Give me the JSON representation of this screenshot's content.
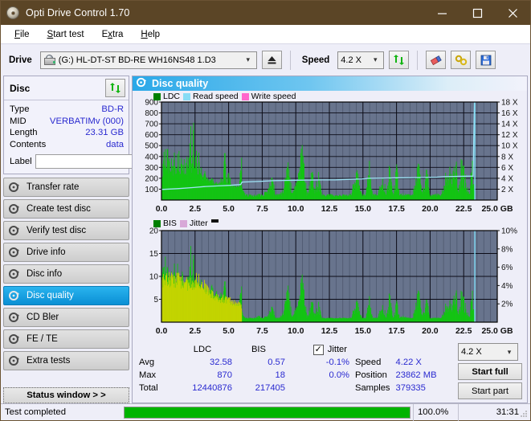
{
  "window": {
    "title": "Opti Drive Control 1.70",
    "icon": "disc-icon",
    "minimize": "minimize-icon",
    "maximize": "maximize-icon",
    "close": "close-icon"
  },
  "menu": [
    {
      "label": "File",
      "accel": "F"
    },
    {
      "label": "Start test",
      "accel": "S"
    },
    {
      "label": "Extra",
      "accel": "x"
    },
    {
      "label": "Help",
      "accel": "H"
    }
  ],
  "toolbar": {
    "drive_label": "Drive",
    "drive_value": "(G:)  HL-DT-ST BD-RE  WH16NS48 1.D3",
    "eject_icon": "eject-icon",
    "speed_label": "Speed",
    "speed_value": "4.2 X",
    "refresh_icon": "refresh-icon",
    "erase_icon": "eraser-icon",
    "tools_icon": "tools-icon",
    "save_icon": "save-disk-icon"
  },
  "disc_panel": {
    "title": "Disc",
    "refresh_icon": "refresh-icon",
    "rows": [
      {
        "key": "Type",
        "value": "BD-R"
      },
      {
        "key": "MID",
        "value": "VERBATIMv (000)"
      },
      {
        "key": "Length",
        "value": "23.31 GB"
      },
      {
        "key": "Contents",
        "value": "data"
      }
    ],
    "label_key": "Label",
    "label_value": "",
    "label_placeholder": "",
    "disc_button_icon": "cd-disc-icon"
  },
  "nav": {
    "items": [
      {
        "label": "Transfer rate",
        "icon": "disc-test-icon",
        "active": false
      },
      {
        "label": "Create test disc",
        "icon": "disc-test-icon",
        "active": false
      },
      {
        "label": "Verify test disc",
        "icon": "disc-test-icon",
        "active": false
      },
      {
        "label": "Drive info",
        "icon": "disc-test-icon",
        "active": false
      },
      {
        "label": "Disc info",
        "icon": "disc-test-icon",
        "active": false
      },
      {
        "label": "Disc quality",
        "icon": "disc-test-icon",
        "active": true
      },
      {
        "label": "CD Bler",
        "icon": "disc-test-icon",
        "active": false
      },
      {
        "label": "FE / TE",
        "icon": "disc-test-icon",
        "active": false
      },
      {
        "label": "Extra tests",
        "icon": "disc-test-icon",
        "active": false
      }
    ],
    "status_window": "Status window > >"
  },
  "content": {
    "header_title": "Disc quality",
    "header_icon": "disc-quality-icon"
  },
  "stats": {
    "col_ldc": "LDC",
    "col_bis": "BIS",
    "jitter_label": "Jitter",
    "jitter_checked": true,
    "rows": [
      {
        "key": "Avg",
        "ldc": "32.58",
        "bis": "0.57",
        "jitter": "-0.1%"
      },
      {
        "key": "Max",
        "ldc": "870",
        "bis": "18",
        "jitter": "0.0%"
      },
      {
        "key": "Total",
        "ldc": "12440876",
        "bis": "217405",
        "jitter": ""
      }
    ],
    "speed_key": "Speed",
    "speed_value": "4.22 X",
    "position_key": "Position",
    "position_value": "23862 MB",
    "samples_key": "Samples",
    "samples_value": "379335",
    "speed_select": "4.2 X",
    "start_full": "Start full",
    "start_part": "Start part"
  },
  "statusbar": {
    "text": "Test completed",
    "percent_label": "100.0%",
    "percent_value": 100,
    "time": "31:31"
  },
  "colors": {
    "titlebar": "#5b4526",
    "accent": "#2aa8e8",
    "value_text": "#2a2ad0",
    "plot_bg": "#68748d",
    "ldc_green": "#13c413",
    "bis_green": "#13c413",
    "jitter_yellow": "#c8d400",
    "read_speed": "#87dcf5",
    "write_speed": "#ff66cc",
    "progress_green": "#00b400"
  },
  "chart_data": [
    {
      "type": "area",
      "title": "Disc quality - LDC",
      "xlabel": "GB",
      "ylabel": "LDC",
      "xlim": [
        0,
        25.0
      ],
      "ylim": [
        0,
        900
      ],
      "y2lim": [
        0,
        18
      ],
      "y2label": "X",
      "xticks": [
        0.0,
        2.5,
        5.0,
        7.5,
        10.0,
        12.5,
        15.0,
        17.5,
        20.0,
        22.5,
        25.0
      ],
      "xticklabels": [
        "0.0",
        "2.5",
        "5.0",
        "7.5",
        "10.0",
        "12.5",
        "15.0",
        "17.5",
        "20.0",
        "22.5",
        "25.0 GB"
      ],
      "yticks": [
        100,
        200,
        300,
        400,
        500,
        600,
        700,
        800,
        900
      ],
      "y2ticks": [
        2,
        4,
        6,
        8,
        10,
        12,
        14,
        16,
        18
      ],
      "y2ticklabels": [
        "2 X",
        "4 X",
        "6 X",
        "8 X",
        "10 X",
        "12 X",
        "14 X",
        "16 X",
        "18 X"
      ],
      "grid": true,
      "legend": [
        {
          "name": "LDC",
          "color": "#008000"
        },
        {
          "name": "Read speed",
          "color": "#87dcf5"
        },
        {
          "name": "Write speed",
          "color": "#ff66cc"
        }
      ],
      "series": [
        {
          "name": "LDC",
          "color": "#13c413",
          "x": [
            0.05,
            0.12,
            0.2,
            0.28,
            0.35,
            0.42,
            0.5,
            0.6,
            0.68,
            0.75,
            0.85,
            0.95,
            1.05,
            1.15,
            1.25,
            1.35,
            1.45,
            1.55,
            1.65,
            1.75,
            1.85,
            1.95,
            2.05,
            2.15,
            2.25,
            2.35,
            2.45,
            2.55,
            2.65,
            2.75,
            2.85,
            2.95,
            3.05,
            3.15,
            3.25,
            3.35,
            3.45,
            3.55,
            3.65,
            3.75,
            3.85,
            3.95,
            4.1,
            4.25,
            4.4,
            4.55,
            4.7,
            4.85,
            5.0,
            5.15,
            5.3,
            5.45,
            5.6,
            5.75,
            5.9,
            6.05,
            6.3,
            6.6,
            6.9,
            7.2,
            7.5,
            7.9,
            8.2,
            8.5,
            8.8,
            9.1,
            9.4,
            9.7,
            9.95,
            10.2,
            10.5,
            10.8,
            10.95,
            11.2,
            11.4,
            11.65,
            11.9,
            12.2,
            12.5,
            12.9,
            13.3,
            13.7,
            14.1,
            14.5,
            14.9,
            15.2,
            15.45,
            15.7,
            16.0,
            16.3,
            16.5,
            16.7,
            16.95,
            17.2,
            17.5,
            17.7,
            17.95,
            18.3,
            18.7,
            19.1,
            19.35,
            19.55,
            19.75,
            19.95,
            20.2,
            20.5,
            20.8,
            21.1,
            21.4,
            21.6,
            21.8,
            21.95,
            22.1,
            22.3,
            22.5,
            22.7,
            22.9,
            23.1,
            23.3
          ],
          "y": [
            200,
            760,
            430,
            560,
            300,
            610,
            300,
            520,
            260,
            580,
            320,
            480,
            250,
            430,
            500,
            380,
            430,
            300,
            390,
            320,
            420,
            380,
            400,
            750,
            330,
            870,
            260,
            620,
            300,
            470,
            250,
            330,
            280,
            300,
            265,
            250,
            230,
            200,
            190,
            215,
            170,
            160,
            195,
            150,
            230,
            155,
            510,
            160,
            330,
            150,
            145,
            140,
            140,
            135,
            495,
            95,
            60,
            55,
            50,
            60,
            55,
            100,
            245,
            60,
            55,
            130,
            390,
            60,
            150,
            275,
            625,
            70,
            160,
            350,
            80,
            290,
            60,
            55,
            60,
            55,
            50,
            55,
            60,
            350,
            55,
            60,
            380,
            60,
            55,
            150,
            280,
            60,
            350,
            60,
            345,
            55,
            65,
            55,
            60,
            440,
            70,
            160,
            345,
            60,
            55,
            60,
            55,
            245,
            330,
            300,
            410,
            355,
            65,
            440,
            345,
            170,
            60,
            420,
            60
          ]
        },
        {
          "name": "Read speed",
          "color": "#87dcf5",
          "x": [
            0.0,
            1.2,
            2.4,
            3.3,
            4.2,
            5.1,
            5.9,
            6.0,
            7.5,
            8.3,
            9.0,
            10.0,
            11.0,
            12.0,
            13.0,
            14.0,
            15.0,
            15.4,
            16.5,
            17.5,
            18.5,
            19.5,
            20.5,
            21.0,
            22.0,
            23.2,
            23.3,
            23.3
          ],
          "y": [
            1.95,
            2.1,
            2.3,
            2.5,
            2.6,
            2.7,
            2.85,
            3.3,
            3.45,
            3.55,
            3.6,
            3.65,
            3.68,
            3.7,
            3.72,
            3.8,
            3.9,
            4.0,
            4.05,
            4.08,
            4.1,
            4.15,
            4.2,
            4.3,
            4.35,
            4.4,
            18.0,
            0.0
          ]
        }
      ]
    },
    {
      "type": "area",
      "title": "Disc quality - BIS / Jitter",
      "xlabel": "GB",
      "ylabel": "BIS",
      "xlim": [
        0,
        25.0
      ],
      "ylim": [
        0,
        20
      ],
      "y2lim": [
        0,
        10
      ],
      "y2label": "%",
      "xticks": [
        0.0,
        2.5,
        5.0,
        7.5,
        10.0,
        12.5,
        15.0,
        17.5,
        20.0,
        22.5,
        25.0
      ],
      "xticklabels": [
        "0.0",
        "2.5",
        "5.0",
        "7.5",
        "10.0",
        "12.5",
        "15.0",
        "17.5",
        "20.0",
        "22.5",
        "25.0 GB"
      ],
      "yticks": [
        5,
        10,
        15,
        20
      ],
      "y2ticks": [
        2,
        4,
        6,
        8,
        10
      ],
      "y2ticklabels": [
        "2%",
        "4%",
        "6%",
        "8%",
        "10%"
      ],
      "grid": true,
      "legend": [
        {
          "name": "BIS",
          "color": "#008000"
        },
        {
          "name": "Jitter",
          "color": "#d8a8d8"
        }
      ],
      "series": [
        {
          "name": "BIS",
          "color": "#13c413",
          "x": [
            0.05,
            0.12,
            0.2,
            0.28,
            0.35,
            0.42,
            0.5,
            0.6,
            0.68,
            0.75,
            0.85,
            0.95,
            1.05,
            1.15,
            1.25,
            1.35,
            1.45,
            1.55,
            1.65,
            1.75,
            1.85,
            1.95,
            2.05,
            2.15,
            2.25,
            2.35,
            2.45,
            2.55,
            2.65,
            2.75,
            2.85,
            2.95,
            3.05,
            3.15,
            3.25,
            3.35,
            3.45,
            3.55,
            3.65,
            3.75,
            3.85,
            3.95,
            4.1,
            4.25,
            4.4,
            4.55,
            4.7,
            4.85,
            5.0,
            5.15,
            5.3,
            5.45,
            5.6,
            5.75,
            5.9,
            6.05,
            6.3,
            6.6,
            6.9,
            7.2,
            7.5,
            7.9,
            8.2,
            8.5,
            8.8,
            9.1,
            9.4,
            9.7,
            9.95,
            10.2,
            10.5,
            10.8,
            10.95,
            11.2,
            11.4,
            11.65,
            11.9,
            12.2,
            12.5,
            12.9,
            13.3,
            13.7,
            14.1,
            14.5,
            14.9,
            15.2,
            15.45,
            15.7,
            16.0,
            16.3,
            16.5,
            16.7,
            16.95,
            17.2,
            17.5,
            17.7,
            17.95,
            18.3,
            18.7,
            19.1,
            19.35,
            19.55,
            19.75,
            19.95,
            20.2,
            20.5,
            20.8,
            21.1,
            21.4,
            21.6,
            21.8,
            21.95,
            22.1,
            22.3,
            22.5,
            22.7,
            22.9,
            23.1,
            23.3
          ],
          "y": [
            13,
            18,
            10,
            17,
            9,
            14,
            8,
            13,
            9,
            14,
            9,
            14,
            8,
            15,
            8,
            14,
            9,
            12,
            8,
            11,
            8,
            12,
            9,
            18,
            9,
            17,
            8,
            12,
            9,
            10,
            8,
            10,
            7,
            9,
            8,
            8,
            7,
            8,
            7,
            9,
            6,
            6,
            8,
            5,
            7,
            5,
            10,
            5,
            5,
            4,
            4,
            4,
            4,
            4,
            10,
            1.5,
            1,
            1,
            1,
            1.5,
            1,
            1.5,
            4,
            1,
            1,
            3,
            9,
            1,
            3,
            5,
            13,
            1.5,
            3,
            6,
            1.5,
            5,
            1,
            1,
            1,
            1,
            1,
            1,
            1,
            6,
            1,
            1,
            6,
            1,
            1,
            3,
            5,
            1,
            7,
            1,
            5,
            1,
            1.5,
            1,
            1,
            9,
            1.5,
            3,
            6,
            1,
            1,
            1,
            1,
            4,
            5,
            5,
            8,
            7,
            1.5,
            8,
            6,
            3,
            1,
            8,
            1
          ]
        },
        {
          "name": "Jitter",
          "color": "#c8d400",
          "x": [
            0.05,
            0.3,
            0.6,
            0.9,
            1.2,
            1.5,
            1.8,
            2.1,
            2.4,
            2.7,
            3.0,
            3.3,
            3.6,
            3.9,
            4.3,
            4.7,
            5.1,
            5.5,
            5.9
          ],
          "y": [
            10,
            10,
            10,
            10,
            10,
            9.5,
            9,
            9,
            9.5,
            10,
            9,
            8,
            7,
            6,
            5.5,
            5.5,
            5,
            4.5,
            4
          ]
        }
      ]
    }
  ]
}
